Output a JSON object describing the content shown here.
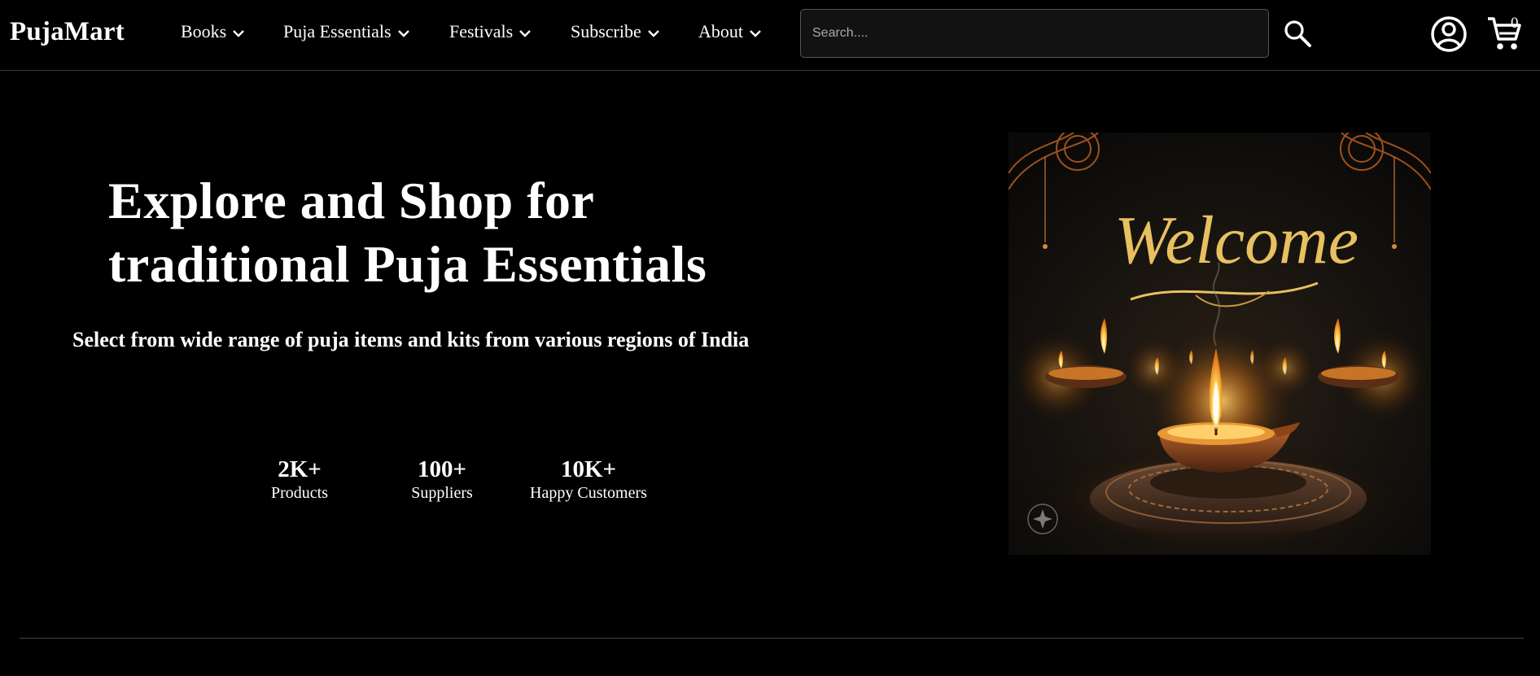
{
  "header": {
    "logo": "PujaMart",
    "nav": [
      {
        "label": "Books"
      },
      {
        "label": "Puja Essentials"
      },
      {
        "label": "Festivals"
      },
      {
        "label": "Subscribe"
      },
      {
        "label": "About"
      }
    ],
    "search": {
      "placeholder": "Search....",
      "value": ""
    },
    "cart_count": "0",
    "icons": {
      "search": "search-icon",
      "account": "account-circle-icon",
      "cart": "shopping-cart-icon",
      "dropdown": "chevron-down-icon"
    }
  },
  "hero": {
    "title_line1": "Explore and Shop for",
    "title_line2": "traditional Puja Essentials",
    "subtitle": "Select from wide range of puja items and kits from various regions of India",
    "stats": [
      {
        "value": "2K+",
        "label": "Products"
      },
      {
        "value": "100+",
        "label": "Suppliers"
      },
      {
        "value": "10K+",
        "label": "Happy Customers"
      }
    ],
    "image": {
      "overlay_text": "Welcome",
      "depicts": "lit diya oil lamps with decorative mandala"
    }
  },
  "colors": {
    "background": "#000000",
    "text": "#ffffff",
    "search_bg": "#121212",
    "border": "#555555",
    "flame": "#f5a623",
    "gold": "#e8c060"
  }
}
